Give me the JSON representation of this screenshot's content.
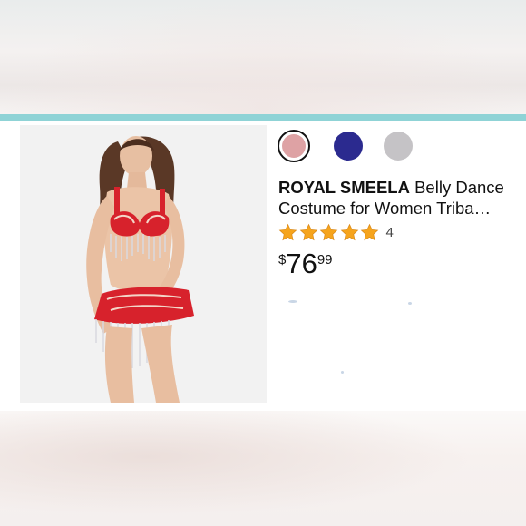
{
  "product": {
    "brand": "ROYAL SMEELA",
    "title_line1": " Belly Dance",
    "title_line2": "Costume for Women Triba…",
    "rating_stars": 5,
    "rating_count": "4",
    "price_currency": "$",
    "price_whole": "76",
    "price_fraction": "99",
    "image": {
      "icon": "product-photo",
      "costume_color": "#d7222c",
      "description_hidden": true
    }
  },
  "swatches": [
    {
      "name": "pink",
      "color": "#dea2a4",
      "selected": true
    },
    {
      "name": "navy",
      "color": "#2b2a8f",
      "selected": false
    },
    {
      "name": "silver",
      "color": "#c5c3c6",
      "selected": false
    }
  ],
  "colors": {
    "accent_teal": "#8fd3d6",
    "star": "#f6a41c"
  }
}
